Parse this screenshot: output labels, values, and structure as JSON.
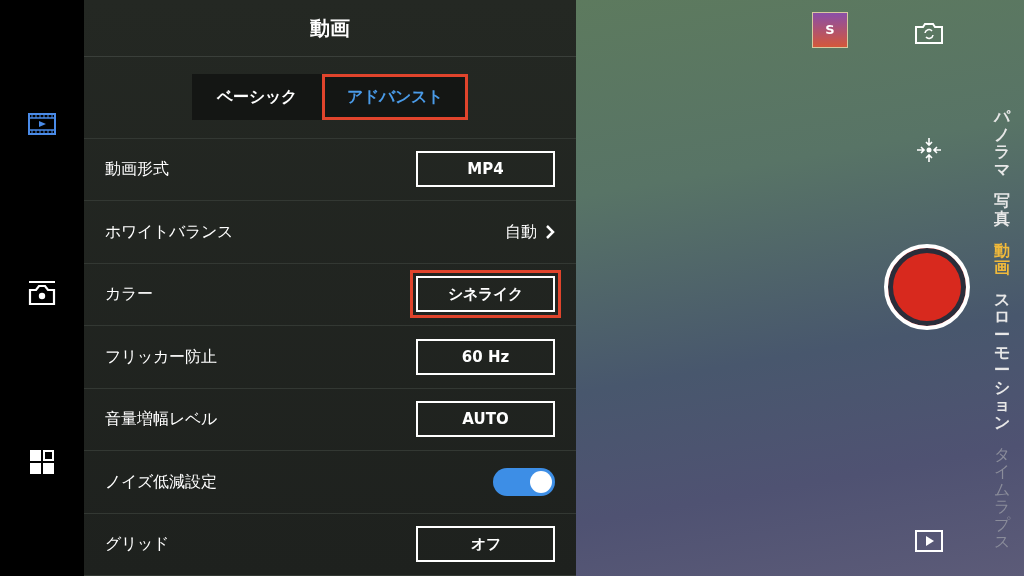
{
  "sidebar": {
    "items": [
      {
        "selected": true
      },
      {
        "selected": false
      },
      {
        "selected": false
      }
    ]
  },
  "panel": {
    "title": "動画",
    "tabs": [
      {
        "label": "ベーシック",
        "selected": false,
        "highlighted": false
      },
      {
        "label": "アドバンスト",
        "selected": true,
        "highlighted": true
      }
    ],
    "settings": [
      {
        "kind": "value",
        "label": "動画形式",
        "value": "MP4"
      },
      {
        "kind": "link",
        "label": "ホワイトバランス",
        "value": "自動"
      },
      {
        "kind": "value",
        "label": "カラー",
        "value": "シネライク",
        "highlighted": true
      },
      {
        "kind": "value",
        "label": "フリッカー防止",
        "value": "60 Hz"
      },
      {
        "kind": "value",
        "label": "音量増幅レベル",
        "value": "AUTO"
      },
      {
        "kind": "toggle",
        "label": "ノイズ低減設定",
        "on": true
      },
      {
        "kind": "value",
        "label": "グリッド",
        "value": "オフ"
      }
    ]
  },
  "camera": {
    "thumbnail": "S",
    "modes": [
      {
        "label": "パノラマ",
        "selected": false,
        "faded": false
      },
      {
        "label": "写真",
        "selected": false,
        "faded": false
      },
      {
        "label": "動画",
        "selected": true,
        "faded": false
      },
      {
        "label": "スローモーション",
        "selected": false,
        "faded": false
      },
      {
        "label": "タイムラプス",
        "selected": false,
        "faded": true
      }
    ]
  }
}
